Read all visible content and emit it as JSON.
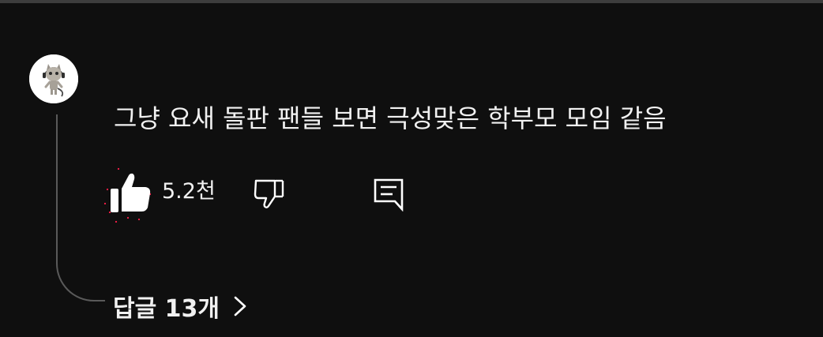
{
  "comment": {
    "text": "그냥 요새 돌판 팬들 보면 극성맞은 학부모 모임 같음",
    "like_count": "5.2천",
    "replies_label": "답글 13개"
  },
  "icons": {
    "like": "thumbs-up-icon",
    "dislike": "thumbs-down-icon",
    "reply": "comment-reply-icon",
    "expand": "chevron-right-icon"
  },
  "colors": {
    "background": "#0f0f0f",
    "text": "#f1f1f1",
    "thread_line": "#5a5a5a",
    "liked_sparkle": "#ff1f4a"
  }
}
